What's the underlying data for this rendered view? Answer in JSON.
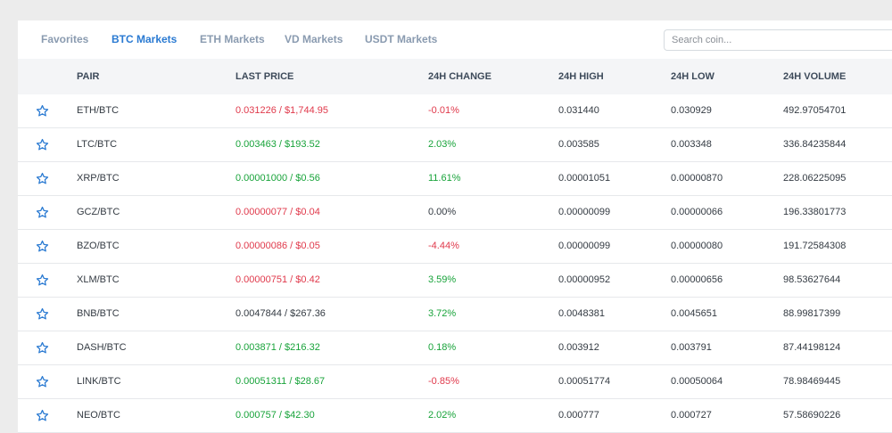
{
  "colors": {
    "accent": "#2a7ad2",
    "positive": "#18a33a",
    "negative": "#e0394b",
    "neutral": "#333a42"
  },
  "tabs": [
    {
      "label": "Favorites",
      "active": false
    },
    {
      "label": "BTC Markets",
      "active": true
    },
    {
      "label": "ETH Markets",
      "active": false
    },
    {
      "label": "VD Markets",
      "active": false
    },
    {
      "label": "USDT Markets",
      "active": false
    }
  ],
  "search": {
    "placeholder": "Search coin..."
  },
  "table": {
    "headers": {
      "pair": "PAIR",
      "last_price": "LAST PRICE",
      "change": "24H CHANGE",
      "high": "24H HIGH",
      "low": "24H LOW",
      "volume": "24H VOLUME"
    },
    "rows": [
      {
        "icon": "star-icon",
        "pair": "ETH/BTC",
        "price": "0.031226 / $1,744.95",
        "price_dir": "down",
        "change": "-0.01%",
        "change_dir": "down",
        "high": "0.031440",
        "low": "0.030929",
        "volume": "492.97054701"
      },
      {
        "icon": "star-icon",
        "pair": "LTC/BTC",
        "price": "0.003463 / $193.52",
        "price_dir": "up",
        "change": "2.03%",
        "change_dir": "up",
        "high": "0.003585",
        "low": "0.003348",
        "volume": "336.84235844"
      },
      {
        "icon": "star-icon",
        "pair": "XRP/BTC",
        "price": "0.00001000 / $0.56",
        "price_dir": "up",
        "change": "11.61%",
        "change_dir": "up",
        "high": "0.00001051",
        "low": "0.00000870",
        "volume": "228.06225095"
      },
      {
        "icon": "star-icon",
        "pair": "GCZ/BTC",
        "price": "0.00000077 / $0.04",
        "price_dir": "down",
        "change": "0.00%",
        "change_dir": "flat",
        "high": "0.00000099",
        "low": "0.00000066",
        "volume": "196.33801773"
      },
      {
        "icon": "star-icon",
        "pair": "BZO/BTC",
        "price": "0.00000086 / $0.05",
        "price_dir": "down",
        "change": "-4.44%",
        "change_dir": "down",
        "high": "0.00000099",
        "low": "0.00000080",
        "volume": "191.72584308"
      },
      {
        "icon": "star-icon",
        "pair": "XLM/BTC",
        "price": "0.00000751 / $0.42",
        "price_dir": "down",
        "change": "3.59%",
        "change_dir": "up",
        "high": "0.00000952",
        "low": "0.00000656",
        "volume": "98.53627644"
      },
      {
        "icon": "star-icon",
        "pair": "BNB/BTC",
        "price": "0.0047844 / $267.36",
        "price_dir": "flat",
        "change": "3.72%",
        "change_dir": "up",
        "high": "0.0048381",
        "low": "0.0045651",
        "volume": "88.99817399"
      },
      {
        "icon": "star-icon",
        "pair": "DASH/BTC",
        "price": "0.003871 / $216.32",
        "price_dir": "up",
        "change": "0.18%",
        "change_dir": "up",
        "high": "0.003912",
        "low": "0.003791",
        "volume": "87.44198124"
      },
      {
        "icon": "star-icon",
        "pair": "LINK/BTC",
        "price": "0.00051311 / $28.67",
        "price_dir": "up",
        "change": "-0.85%",
        "change_dir": "down",
        "high": "0.00051774",
        "low": "0.00050064",
        "volume": "78.98469445"
      },
      {
        "icon": "star-icon",
        "pair": "NEO/BTC",
        "price": "0.000757 / $42.30",
        "price_dir": "up",
        "change": "2.02%",
        "change_dir": "up",
        "high": "0.000777",
        "low": "0.000727",
        "volume": "57.58690226"
      }
    ]
  }
}
